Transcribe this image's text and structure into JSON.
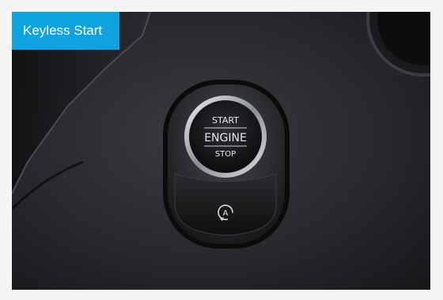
{
  "caption": {
    "title": "Keyless Start",
    "badge_color": "#0ea3e0"
  },
  "button": {
    "line_top": "START",
    "line_middle": "ENGINE",
    "line_bottom": "STOP",
    "auto_icon_letter": "A",
    "ring_color": "#c9ccd0"
  },
  "icons": [
    "start-stop-button-icon",
    "auto-start-stop-icon"
  ]
}
